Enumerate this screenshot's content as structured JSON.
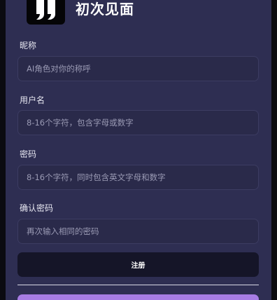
{
  "header": {
    "title": "初次见面",
    "logo_icon": "logo-icon"
  },
  "form": {
    "nickname": {
      "label": "昵称",
      "placeholder": "AI角色对你的称呼",
      "value": ""
    },
    "username": {
      "label": "用户名",
      "placeholder": "8-16个字符，包含字母或数字",
      "value": ""
    },
    "password": {
      "label": "密码",
      "placeholder": "8-16个字符，同时包含英文字母和数字",
      "value": ""
    },
    "confirm_password": {
      "label": "确认密码",
      "placeholder": "再次输入相同的密码",
      "value": ""
    },
    "submit_label": "注册"
  },
  "colors": {
    "panel": "#2e2e52",
    "input_bg": "#2a2a4a",
    "button_bg": "#151528",
    "accent": "#a77ce4"
  }
}
